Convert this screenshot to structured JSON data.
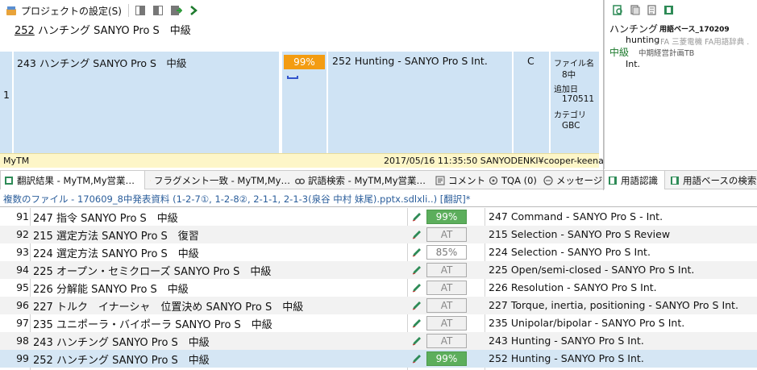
{
  "toolbar": {
    "settings_label": "プロジェクトの設定(S)"
  },
  "source_line": {
    "num": "252",
    "text": " ハンチング SANYO Pro S　中級"
  },
  "tm_match": {
    "row_number": "1",
    "source": "243 ハンチング SANYO Pro S　中級",
    "score": "99%",
    "target": "252 Hunting - SANYO Pro S Int.",
    "flag": "C",
    "meta": [
      "ファイル名",
      "8中",
      "追加日",
      "170511",
      "カテゴリ",
      "GBC"
    ],
    "footer_left": "MyTM",
    "footer_right": "2017/05/16 11:35:50  SANYODENKI¥cooper-keenan",
    "colors": {
      "score_bg": "#f39c12",
      "cell_bg": "#cfe3f4",
      "footer_bg": "#fdf6c8"
    }
  },
  "termbase": {
    "term1": "ハンチング",
    "term1_base": "用語ベース_170209",
    "term1_translation": "hunting",
    "term1_note": "FA  三菱電機  FA用語辞典 .",
    "term2": "中級",
    "term2_base": "中期経営計画TB",
    "term2_translation": "Int."
  },
  "tabs": [
    {
      "label": "翻訳結果 - MyTM,My営業…",
      "icon": "translation-results-icon"
    },
    {
      "label": "フラグメント一致 - MyTM,My…",
      "icon": "fragment-match-icon"
    },
    {
      "label": "訳語検索 - MyTM,My営業…",
      "icon": "concordance-icon"
    },
    {
      "label": "コメント",
      "icon": "comment-icon"
    },
    {
      "label": "TQA (0)",
      "icon": "tqa-icon"
    },
    {
      "label": "メッセージ",
      "icon": "message-icon"
    }
  ],
  "right_tabs": [
    {
      "label": "用語認識",
      "icon": "term-recognition-icon"
    },
    {
      "label": "用語ベースの検索",
      "icon": "termbase-search-icon"
    }
  ],
  "document_title": "複数のファイル - 170609_8中発表資料 (1-2-7①, 1-2-8②, 2-1-1, 2-1-3(泉谷 中村 妹尾).pptx.sdlxli..) [翻訳]*",
  "rows": [
    {
      "num": "91",
      "source": "247 指令 SANYO Pro S　中級",
      "status": "99%",
      "status_type": "green",
      "target": "247 Command - SANYO Pro S - Int."
    },
    {
      "num": "92",
      "source": "215 選定方法 SANYO Pro S　復習",
      "status": "AT",
      "status_type": "at",
      "target": "215 Selection - SANYO Pro S Review"
    },
    {
      "num": "93",
      "source": "224 選定方法 SANYO Pro S　中級",
      "status": "85%",
      "status_type": "pct",
      "target": "224 Selection - SANYO Pro S Int."
    },
    {
      "num": "94",
      "source": "225 オープン・セミクローズ SANYO Pro S　中級",
      "status": "AT",
      "status_type": "at",
      "target": "225 Open/semi-closed - SANYO Pro S Int."
    },
    {
      "num": "95",
      "source": "226 分解能 SANYO Pro S　中級",
      "status": "AT",
      "status_type": "at",
      "target": "226 Resolution - SANYO Pro S Int."
    },
    {
      "num": "96",
      "source": "227 トルク　イナーシャ　位置決め SANYO Pro S　中級",
      "status": "AT",
      "status_type": "at",
      "target": "227 Torque, inertia, positioning - SANYO Pro S Int."
    },
    {
      "num": "97",
      "source": "235 ユニポーラ・バイポーラ SANYO Pro S　中級",
      "status": "AT",
      "status_type": "at",
      "target": "235 Unipolar/bipolar - SANYO Pro S Int."
    },
    {
      "num": "98",
      "source": "243 ハンチング SANYO Pro S　中級",
      "status": "AT",
      "status_type": "at",
      "target": "243 Hunting - SANYO Pro S Int."
    },
    {
      "num": "99",
      "source": "252 ハンチング SANYO Pro S　中級",
      "status": "99%",
      "status_type": "green",
      "target": "252 Hunting - SANYO Pro S Int."
    }
  ]
}
